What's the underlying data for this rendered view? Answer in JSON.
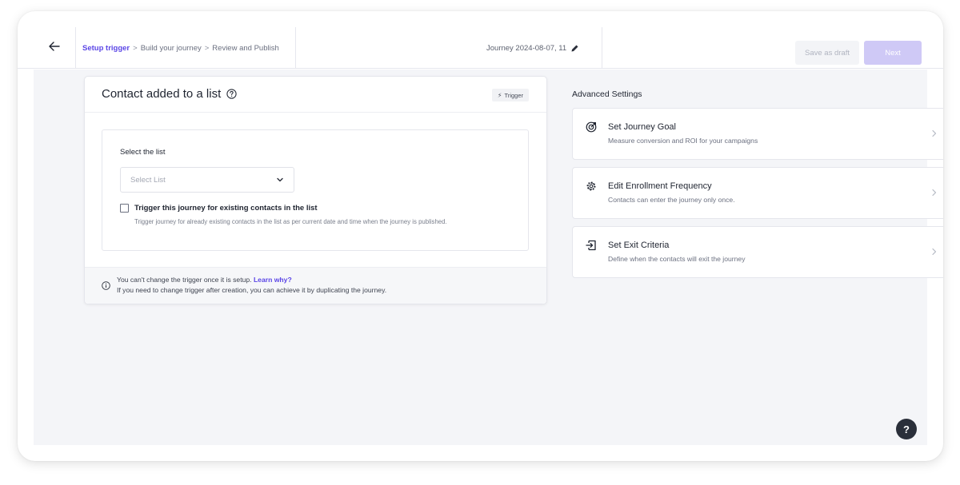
{
  "header": {
    "breadcrumbs": [
      {
        "label": "Setup trigger"
      },
      {
        "label": "Build your journey"
      },
      {
        "label": "Review and Publish"
      }
    ],
    "breadcrumb_separator": ">",
    "journey_name": "Journey 2024-08-07, 11",
    "save_draft_label": "Save as draft",
    "next_label": "Next"
  },
  "trigger": {
    "title": "Contact added to a list",
    "badge": "Trigger",
    "select_label": "Select the list",
    "select_placeholder": "Select List",
    "checkbox_label": "Trigger this journey for existing contacts in the list",
    "checkbox_checked": false,
    "checkbox_description": "Trigger journey for already existing contacts in the list as per current date and time when the journey is published.",
    "footer_line1": "You can't change the trigger once it is setup.",
    "footer_link": "Learn why?",
    "footer_line2": "If you need to change trigger after creation, you can achieve it by duplicating the journey."
  },
  "advanced": {
    "title": "Advanced Settings",
    "items": [
      {
        "icon": "target-icon",
        "title": "Set Journey Goal",
        "description": "Measure conversion and ROI for your campaigns"
      },
      {
        "icon": "gear-icon",
        "title": "Edit Enrollment Frequency",
        "description": "Contacts can enter the journey only once."
      },
      {
        "icon": "exit-icon",
        "title": "Set Exit Criteria",
        "description": "Define when the contacts will exit the journey"
      }
    ]
  },
  "help_button": "?",
  "colors": {
    "accent": "#5b46e6",
    "next_disabled": "#cfc9f6",
    "content_background": "#f4f5f8"
  }
}
